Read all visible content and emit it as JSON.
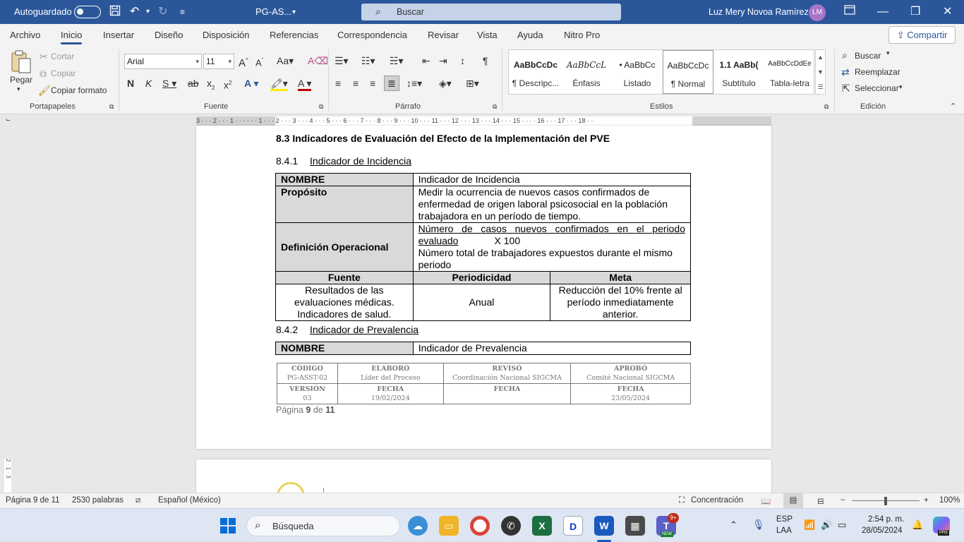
{
  "titlebar": {
    "autosave_label": "Autoguardado",
    "doc_name": "PG-AS...",
    "search_placeholder": "Buscar",
    "user_name": "Luz Mery Novoa Ramírez",
    "user_initials": "LM"
  },
  "menu": {
    "tabs": [
      "Archivo",
      "Inicio",
      "Insertar",
      "Diseño",
      "Disposición",
      "Referencias",
      "Correspondencia",
      "Revisar",
      "Vista",
      "Ayuda",
      "Nitro Pro"
    ],
    "active": "Inicio",
    "share_label": "Compartir"
  },
  "ribbon": {
    "clipboard": {
      "paste_label": "Pegar",
      "cut_label": "Cortar",
      "copy_label": "Copiar",
      "format_painter_label": "Copiar formato",
      "group_label": "Portapapeles"
    },
    "font": {
      "font_name": "Arial",
      "font_size": "11",
      "group_label": "Fuente"
    },
    "paragraph": {
      "group_label": "Párrafo"
    },
    "styles": {
      "group_label": "Estilos",
      "items": [
        {
          "sample": "AaBbCcDc",
          "name": "¶ Descripc..."
        },
        {
          "sample": "AaBbCcL",
          "name": "Énfasis"
        },
        {
          "sample": "• AaBbCc",
          "name": "Listado"
        },
        {
          "sample": "AaBbCcDc",
          "name": "¶ Normal"
        },
        {
          "sample": "1.1 AaBb(",
          "name": "Subtítulo"
        },
        {
          "sample": "AaBbCcDdEe",
          "name": "Tabla-letra"
        }
      ],
      "selected": "¶ Normal"
    },
    "editing": {
      "find_label": "Buscar",
      "replace_label": "Reemplazar",
      "select_label": "Seleccionar",
      "group_label": "Edición"
    }
  },
  "ruler": {
    "numbers": "3 · · · 2 · · · 1 · · · · · · 1 · · · 2 · · · 3 · · · 4 · · · 5 · · · 6 · · · 7 · · · 8 · · · 9 · · · 10 · · · 11 · · · 12 · · · 13 · · · 14 · · · 15 · · · · 16 · · · 17 · · · 18 · ·"
  },
  "document": {
    "heading": "8.3 Indicadores de Evaluación del Efecto de la Implementación del PVE",
    "section1": {
      "number": "8.4.1",
      "title": "Indicador de Incidencia",
      "table": {
        "nombre_label": "NOMBRE",
        "nombre_value": "Indicador de Incidencia",
        "proposito_label": "Propósito",
        "proposito_value": "Medir la ocurrencia de nuevos casos confirmados de enfermedad de origen laboral psicosocial en la población trabajadora en un período de tiempo.",
        "definicion_label": "Definición Operacional",
        "definicion_numerator_1": "Número de casos nuevos confirmados en el periodo",
        "definicion_numerator_2": "evaluado",
        "definicion_multiplier": "X 100",
        "definicion_denominator": "Número total de trabajadores expuestos durante el mismo periodo",
        "col_fuente": "Fuente",
        "col_periodicidad": "Periodicidad",
        "col_meta": "Meta",
        "fuente_value": "Resultados de las evaluaciones médicas. Indicadores de salud.",
        "periodicidad_value": "Anual",
        "meta_value": "Reducción del 10% frente al período inmediatamente anterior."
      }
    },
    "section2": {
      "number": "8.4.2",
      "title": "Indicador de Prevalencia",
      "nombre_label": "NOMBRE",
      "nombre_value": "Indicador de Prevalencia"
    },
    "footer": {
      "codigo_label": "CÓDIGO",
      "codigo_value": "PG-ASST-02",
      "elaboro_label": "ELABORÓ",
      "elaboro_value": "Líder del Proceso",
      "reviso_label": "REVISÓ",
      "reviso_value": "Coordinación Nacional SIGCMA",
      "aprobo_label": "APROBÓ",
      "aprobo_value": "Comité Nacional SIGCMA",
      "version_label": "VERSIÓN",
      "version_value": "03",
      "fecha1_label": "FECHA",
      "fecha1_value": "19/02/2024",
      "fecha2_label": "FECHA",
      "fecha3_label": "FECHA",
      "fecha3_value": "23/05/2024"
    },
    "page_prefix": "Página",
    "page_current": "9",
    "page_of": "de",
    "page_total": "11"
  },
  "statusbar": {
    "page_info": "Página 9 de 11",
    "word_count": "2530 palabras",
    "language": "Español (México)",
    "focus_label": "Concentración",
    "zoom_minus": "−",
    "zoom_plus": "+",
    "zoom_level": "100%"
  },
  "taskbar": {
    "search_placeholder": "Búsqueda",
    "teams_badge": "9+",
    "teams_new": "NEW",
    "lang_line1": "ESP",
    "lang_line2": "LAA",
    "time": "2:54 p. m.",
    "date": "28/05/2024",
    "copilot_badge": "PRE"
  },
  "vertical_ruler": "2 · 1 · 3",
  "colors": {
    "word_blue": "#2b579a",
    "table_label_bg": "#d9d9d9",
    "avatar": "#a975c9",
    "excel_green": "#1d6f42",
    "word_app": "#185abd"
  }
}
